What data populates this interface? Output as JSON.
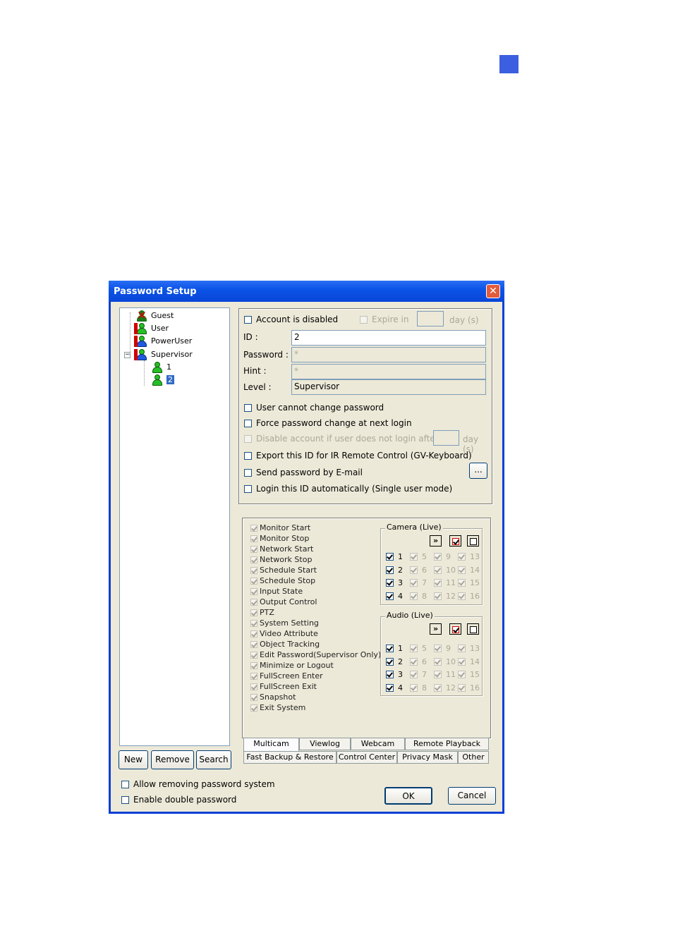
{
  "dialog": {
    "title": "Password Setup",
    "close_glyph": "✕"
  },
  "tree": [
    {
      "label": "Guest",
      "icon": "guest-user-icon"
    },
    {
      "label": "User",
      "icon": "user-icon"
    },
    {
      "label": "PowerUser",
      "icon": "power-user-icon"
    },
    {
      "label": "Supervisor",
      "icon": "supervisor-icon",
      "expander": "−"
    },
    {
      "label": "1",
      "icon": "user-icon"
    },
    {
      "label": "2",
      "icon": "user-icon",
      "selected": true
    }
  ],
  "tree_buttons": {
    "new": "New",
    "remove": "Remove",
    "search": "Search"
  },
  "account": {
    "disabled_label": "Account is disabled",
    "expire_label": "Expire in",
    "expire_unit": "day (s)",
    "id_label": "ID :",
    "id_value": "2",
    "password_label": "Password :",
    "password_value": "*",
    "hint_label": "Hint :",
    "hint_value": "*",
    "level_label": "Level :",
    "level_value": "Supervisor",
    "opt_cannot_change": "User cannot change password",
    "opt_force_change": "Force password change at next login",
    "opt_disable_after": "Disable account if user does not login after",
    "disable_unit": "day (s)",
    "opt_export_ir": "Export this ID for IR Remote Control (GV-Keyboard)",
    "opt_send_email": "Send password by E-mail",
    "email_btn": "...",
    "opt_auto_login": "Login this ID automatically (Single user mode)"
  },
  "permissions": [
    "Monitor Start",
    "Monitor Stop",
    "Network Start",
    "Network Stop",
    "Schedule Start",
    "Schedule Stop",
    "Input State",
    "Output Control",
    "PTZ",
    "System Setting",
    "Video Attribute",
    "Object Tracking",
    "Edit Password(Supervisor Only)",
    "Minimize or Logout",
    "FullScreen Enter",
    "FullScreen Exit",
    "Snapshot",
    "Exit System"
  ],
  "camera_group": {
    "title": "Camera (Live)"
  },
  "audio_group": {
    "title": "Audio (Live)"
  },
  "channel_rows": [
    [
      "1",
      "5",
      "9",
      "13"
    ],
    [
      "2",
      "6",
      "10",
      "14"
    ],
    [
      "3",
      "7",
      "11",
      "15"
    ],
    [
      "4",
      "8",
      "12",
      "16"
    ]
  ],
  "group_buttons": {
    "advance": "»"
  },
  "tabs_top": [
    "Multicam",
    "Viewlog",
    "Webcam",
    "Remote Playback"
  ],
  "tabs_bottom": [
    "Fast Backup & Restore",
    "Control Center",
    "Privacy Mask",
    "Other"
  ],
  "footer": {
    "allow_remove": "Allow removing password system",
    "double_password": "Enable double password",
    "ok": "OK",
    "cancel": "Cancel"
  }
}
